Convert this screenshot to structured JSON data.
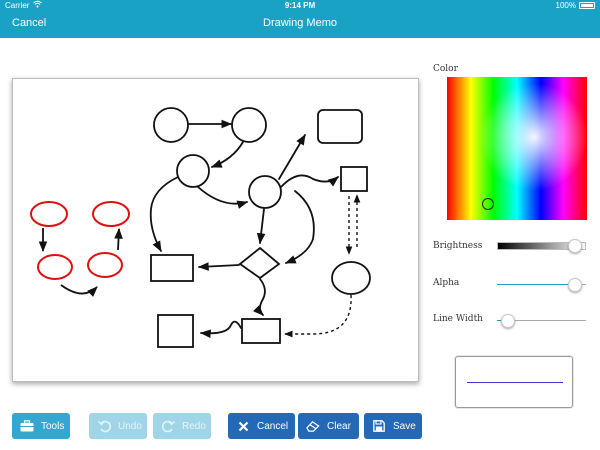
{
  "status_bar": {
    "carrier": "Carrier",
    "time": "9:14 PM",
    "battery": "100%"
  },
  "nav_bar": {
    "cancel_label": "Cancel",
    "title": "Drawing Memo"
  },
  "panel": {
    "color_label": "Color",
    "brightness_label": "Brightness",
    "alpha_label": "Alpha",
    "line_width_label": "Line Width",
    "brightness_value": 0.95,
    "alpha_value": 0.95,
    "line_width_value": 0.05,
    "selected_color": "#3a3ad6"
  },
  "toolbar": {
    "tools_label": "Tools",
    "undo_label": "Undo",
    "redo_label": "Redo",
    "cancel_label": "Cancel",
    "clear_label": "Clear",
    "save_label": "Save"
  },
  "colors": {
    "accent": "#1aa2c5",
    "primary_button": "#2469b5",
    "disabled_button": "#9fd5e7",
    "stroke_black": "#111111",
    "stroke_red": "#dd1111"
  }
}
